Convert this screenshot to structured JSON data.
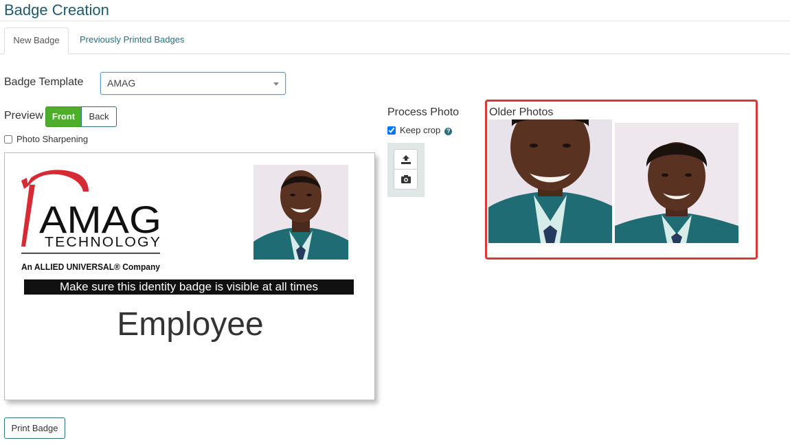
{
  "page": {
    "title": "Badge Creation"
  },
  "tabs": [
    {
      "label": "New Badge",
      "active": true
    },
    {
      "label": "Previously Printed Badges",
      "active": false
    }
  ],
  "template": {
    "label": "Badge Template",
    "selected": "AMAG"
  },
  "preview": {
    "label": "Preview",
    "front": "Front",
    "back": "Back",
    "selected": "Front"
  },
  "photo_sharpening": {
    "label": "Photo Sharpening",
    "checked": false
  },
  "badge": {
    "logo_word": "AMAG",
    "logo_sub": "TECHNOLOGY",
    "logo_tagline": "An ALLIED UNIVERSAL® Company",
    "banner": "Make sure this identity badge is visible at all times",
    "role": "Employee"
  },
  "process_photo": {
    "label": "Process Photo",
    "keep_crop_label": "Keep crop",
    "keep_crop_checked": true,
    "upload_icon": "upload-icon",
    "camera_icon": "camera-icon"
  },
  "older_photos": {
    "label": "Older Photos",
    "count": 2
  },
  "actions": {
    "print": "Print Badge"
  },
  "colors": {
    "title": "#1e5a6e",
    "link": "#2a6f80",
    "front_active": "#4caf2a",
    "highlight_border": "#d9383a",
    "logo_red": "#d62a35"
  }
}
